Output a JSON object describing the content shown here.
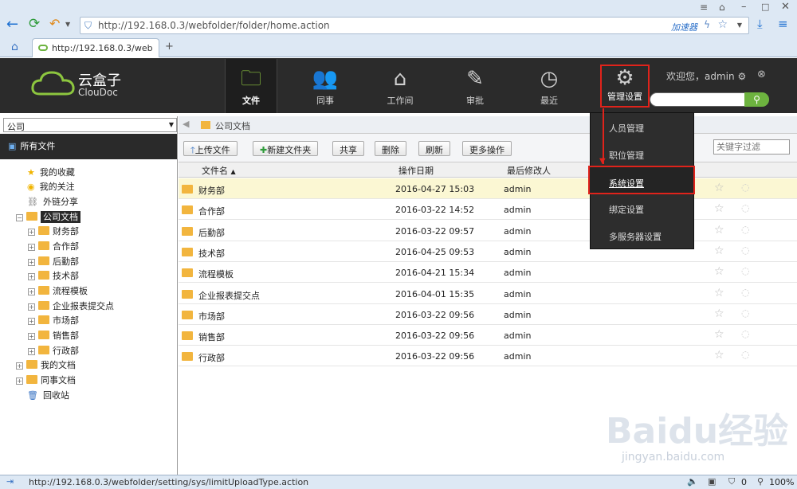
{
  "browser": {
    "url": "http://192.168.0.3/webfolder/folder/home.action",
    "accelerator": "加速器",
    "tab_title": "http://192.168.0.3/web",
    "status_url": "http://192.168.0.3/webfolder/setting/sys/limitUploadType.action",
    "status_count": "0",
    "zoom": "100%"
  },
  "logo": {
    "cn": "云盒子",
    "en": "ClouDoc"
  },
  "nav": [
    {
      "label": "文件",
      "icon": "folder-icon",
      "active": true
    },
    {
      "label": "同事",
      "icon": "colleagues-icon"
    },
    {
      "label": "工作间",
      "icon": "workspace-icon"
    },
    {
      "label": "审批",
      "icon": "approval-icon"
    },
    {
      "label": "最近",
      "icon": "clock-icon"
    },
    {
      "label": "管理设置",
      "icon": "gear-icon"
    }
  ],
  "welcome": "欢迎您，admin",
  "left": {
    "select_value": "公司",
    "all_files": "所有文件",
    "tree": [
      {
        "label": "我的收藏",
        "icon": "star-icon"
      },
      {
        "label": "我的关注",
        "icon": "bulb-icon"
      },
      {
        "label": "外链分享",
        "icon": "share-icon"
      },
      {
        "label": "公司文档",
        "icon": "company-docs-icon"
      },
      {
        "label": "财务部"
      },
      {
        "label": "合作部"
      },
      {
        "label": "后勤部"
      },
      {
        "label": "技术部"
      },
      {
        "label": "流程模板"
      },
      {
        "label": "企业报表提交点"
      },
      {
        "label": "市场部"
      },
      {
        "label": "销售部"
      },
      {
        "label": "行政部"
      },
      {
        "label": "我的文档"
      },
      {
        "label": "同事文档"
      },
      {
        "label": "回收站",
        "icon": "recycle-bin-icon"
      }
    ]
  },
  "breadcrumb": "公司文档",
  "toolbar": {
    "upload": "上传文件",
    "new_folder": "新建文件夹",
    "share": "共享",
    "delete": "删除",
    "refresh": "刷新",
    "more": "更多操作",
    "filter_placeholder": "关键字过滤"
  },
  "table": {
    "headers": [
      "文件名",
      "操作日期",
      "最后修改人"
    ],
    "rows": [
      {
        "name": "财务部",
        "date": "2016-04-27 15:03",
        "user": "admin"
      },
      {
        "name": "合作部",
        "date": "2016-03-22 14:52",
        "user": "admin"
      },
      {
        "name": "后勤部",
        "date": "2016-03-22 09:57",
        "user": "admin"
      },
      {
        "name": "技术部",
        "date": "2016-04-25 09:53",
        "user": "admin"
      },
      {
        "name": "流程模板",
        "date": "2016-04-21 15:34",
        "user": "admin"
      },
      {
        "name": "企业报表提交点",
        "date": "2016-04-01 15:35",
        "user": "admin"
      },
      {
        "name": "市场部",
        "date": "2016-03-22 09:56",
        "user": "admin"
      },
      {
        "name": "销售部",
        "date": "2016-03-22 09:56",
        "user": "admin"
      },
      {
        "name": "行政部",
        "date": "2016-03-22 09:56",
        "user": "admin"
      }
    ]
  },
  "admin_menu": [
    "人员管理",
    "职位管理",
    "系统设置",
    "绑定设置",
    "多服务器设置"
  ],
  "watermark": {
    "main": "Baidu经验",
    "sub": "jingyan.baidu.com"
  }
}
